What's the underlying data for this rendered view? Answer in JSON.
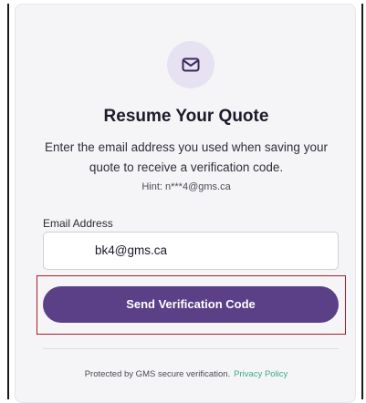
{
  "card": {
    "icon": "mail-icon",
    "title": "Resume Your Quote",
    "description": "Enter the email address you used when saving your quote to receive a verification code.",
    "hint": "Hint: n***4@gms.ca"
  },
  "form": {
    "email_label": "Email Address",
    "email_value": "bk4@gms.ca",
    "submit_label": "Send Verification Code"
  },
  "footer": {
    "text": "Protected by GMS secure verification.",
    "link_label": "Privacy Policy"
  },
  "colors": {
    "accent": "#5b3f87",
    "icon_bg": "#e7e2f1",
    "link": "#3fa88a",
    "highlight": "#a61c2b"
  }
}
